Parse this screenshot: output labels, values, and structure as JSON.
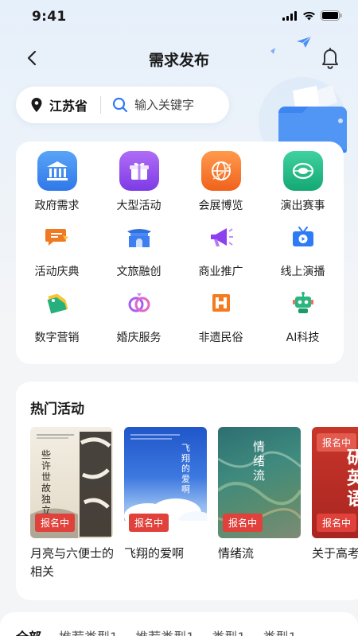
{
  "status_bar": {
    "time": "9:41"
  },
  "nav": {
    "title": "需求发布"
  },
  "search": {
    "location": "江苏省",
    "placeholder": "输入关键字"
  },
  "categories": [
    {
      "label": "政府需求",
      "icon": "government-icon"
    },
    {
      "label": "大型活动",
      "icon": "gift-box-icon"
    },
    {
      "label": "会展博览",
      "icon": "globe-icon"
    },
    {
      "label": "演出赛事",
      "icon": "stadium-icon"
    },
    {
      "label": "活动庆典",
      "icon": "chat-flag-icon"
    },
    {
      "label": "文旅融创",
      "icon": "gate-icon"
    },
    {
      "label": "商业推广",
      "icon": "megaphone-icon"
    },
    {
      "label": "线上演播",
      "icon": "tv-icon"
    },
    {
      "label": "数字营销",
      "icon": "tag-icon"
    },
    {
      "label": "婚庆服务",
      "icon": "rings-icon"
    },
    {
      "label": "非遗民俗",
      "icon": "pattern-icon"
    },
    {
      "label": "AI科技",
      "icon": "robot-icon"
    }
  ],
  "hot": {
    "title": "热门活动",
    "badge": "报名中",
    "items": [
      {
        "name": "月亮与六便士的相关",
        "cover_text": "些许世故独立事"
      },
      {
        "name": "飞翔的爱啊",
        "cover_text": "飞翔的爱啊"
      },
      {
        "name": "情绪流",
        "cover_text": "情绪流"
      },
      {
        "name": "关于高考高考",
        "cover_text": "研英语"
      }
    ]
  },
  "tabs": [
    "全部",
    "推荐类型1",
    "推荐类型1",
    "类型1",
    "类型1"
  ],
  "colors": {
    "accent": "#2f7bf5",
    "badge": "#e0413a"
  }
}
